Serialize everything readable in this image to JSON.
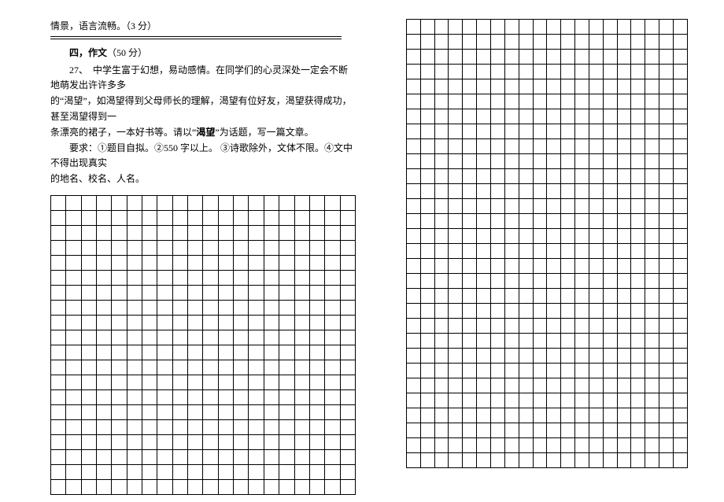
{
  "leftColumn": {
    "prevTrail": "情景，语言流畅。（3 分）",
    "heading_prefix": "四，作文",
    "heading_points": "（50 分）",
    "q27_a": "27、　中学生富于幻想，易动感情。在同学们的心灵深处一定会不断地萌发出许许多多",
    "q27_b": "的“渴望”，如渴望得到父母师长的理解，渴望有位好友，渴望获得成功，甚至渴望得到一",
    "q27_c": "条漂亮的裙子，一本好书等。请以“",
    "q27_c_bold": "渴望",
    "q27_c_after": "”为话题，写一篇文章。",
    "req_a": "要求：①题目自拟。②550 字以上。 ③诗歌除外，文体不限。④文中不得出现真实",
    "req_b": "的地名、校名、人名。"
  },
  "gridLeft": {
    "cols": 20,
    "rows": 20
  },
  "gridRight": {
    "cols": 20,
    "rows": 30
  }
}
